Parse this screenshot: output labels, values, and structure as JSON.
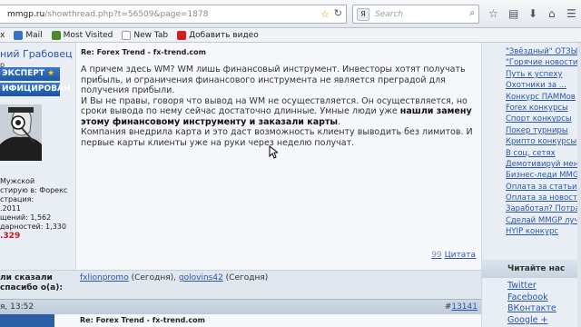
{
  "browser": {
    "url_domain": "mmgp.ru",
    "url_path": "/showthread.php?t=56509&page=1878",
    "search_placeholder": "Search",
    "search_engine_letter": "Я"
  },
  "bookmarks": [
    {
      "label": "x",
      "color": "#e8e8e8"
    },
    {
      "label": "Mail",
      "color": "#3b73c4"
    },
    {
      "label": "Most Visited",
      "color": "#4a8a2a"
    },
    {
      "label": "New Tab",
      "color": "#ffffff"
    },
    {
      "label": "Добавить видео",
      "color": "#d11f1f"
    }
  ],
  "user": {
    "name": "ний Грабовец",
    "rank": "р",
    "badge_expert": "ЭКСПЕРТ",
    "badge_expert_star": "★",
    "badge_cert": "ИФИЦИРОВАН",
    "stats": [
      "Мужской",
      "стирую в: Форекс",
      "страция:",
      ".2011",
      "щений: 1,562",
      "дарностей: 1,330"
    ],
    "reputation": ".329"
  },
  "post": {
    "title": "Re: Forex Trend - fx-trend.com",
    "p1": "А причем здесь WM? WM лишь финансовый инструмент. Инвесторы хотят получать прибыль, и ограничения финансового инструмента не является преградой для получения прибыли.",
    "p2_start": "И Вы не правы, говоря что вывод на WM не осуществляется. Он осуществляется, но сроки вывода по нему сейчас достаточно длинные. Умные люди уже ",
    "p2_bold": "нашли замену этому финансовому инструменту и заказали карты",
    "p2_end": ".",
    "p3": "Компания внедрила карта и это даст возможность клиенту выводить без лимитов. И первые карты клиенты уже на руки через неделю получат.",
    "quote_icon": "99",
    "quote_label": "Цитата"
  },
  "thanks": {
    "label": "ли сказали спасибо о(а):",
    "user1": "fxlionpromo",
    "today1": " (Сегодня), ",
    "user2": "golovins42",
    "today2": " (Сегодня)"
  },
  "next_post": {
    "date": "я, 13:52",
    "num_prefix": "#",
    "num": "13141",
    "title": "Re: Forex Trend - fx-trend.com"
  },
  "sidebar": {
    "links": [
      "\"Звёздный\" ОТЗЫВ!",
      "\"Горячие новости\"",
      "Путь к успеху",
      "Охотники за ...",
      "Конкурс ПАММов",
      "Forex конкурсы",
      "Спорт конкурсы",
      "Покер турниры",
      "Крипто конкурсы",
      "В соц. сетях",
      "Демотивируй меня",
      "Бизнес-леди MMGP",
      "Оплата за статьи",
      "Оплата за новости",
      "Заработал? Потрать",
      "Сделай MMGP лучше",
      "HYIP конкурс"
    ],
    "read_header": "Читайте нас",
    "read_links": [
      "Twitter",
      "Facebook",
      "ВКонтакте",
      "Google +"
    ]
  }
}
